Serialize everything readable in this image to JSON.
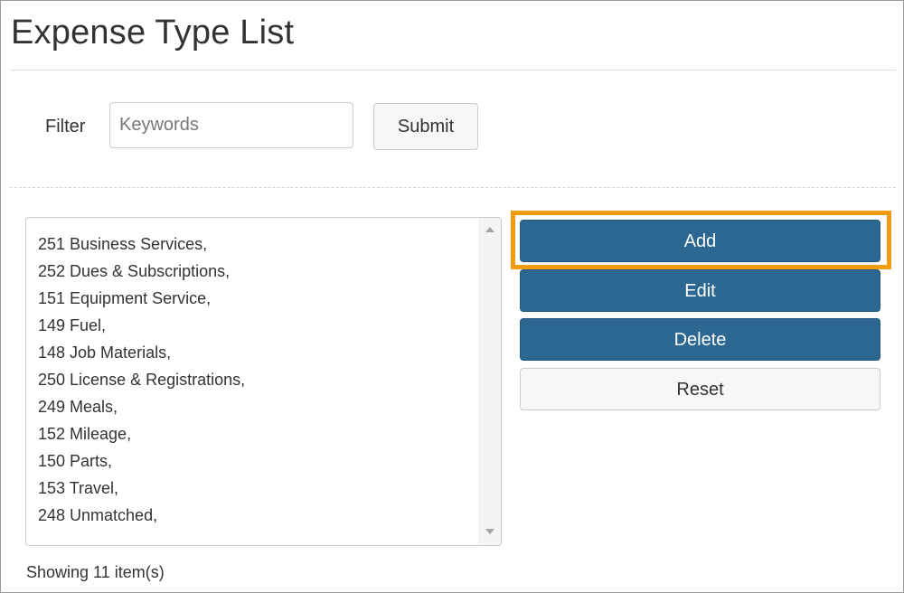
{
  "page": {
    "title": "Expense Type List"
  },
  "filter": {
    "label": "Filter",
    "placeholder": "Keywords",
    "value": "",
    "submit_label": "Submit"
  },
  "list": {
    "items": [
      "251 Business Services,",
      "252 Dues & Subscriptions,",
      "151 Equipment Service,",
      "149 Fuel,",
      "148 Job Materials,",
      "250 License & Registrations,",
      "249 Meals,",
      "152 Mileage,",
      "150 Parts,",
      "153 Travel,",
      "248 Unmatched,"
    ]
  },
  "actions": {
    "add_label": "Add",
    "edit_label": "Edit",
    "delete_label": "Delete",
    "reset_label": "Reset"
  },
  "footer": {
    "count_text": "Showing 11 item(s)"
  },
  "colors": {
    "primary_button": "#2b6790",
    "highlight": "#f39c12"
  }
}
